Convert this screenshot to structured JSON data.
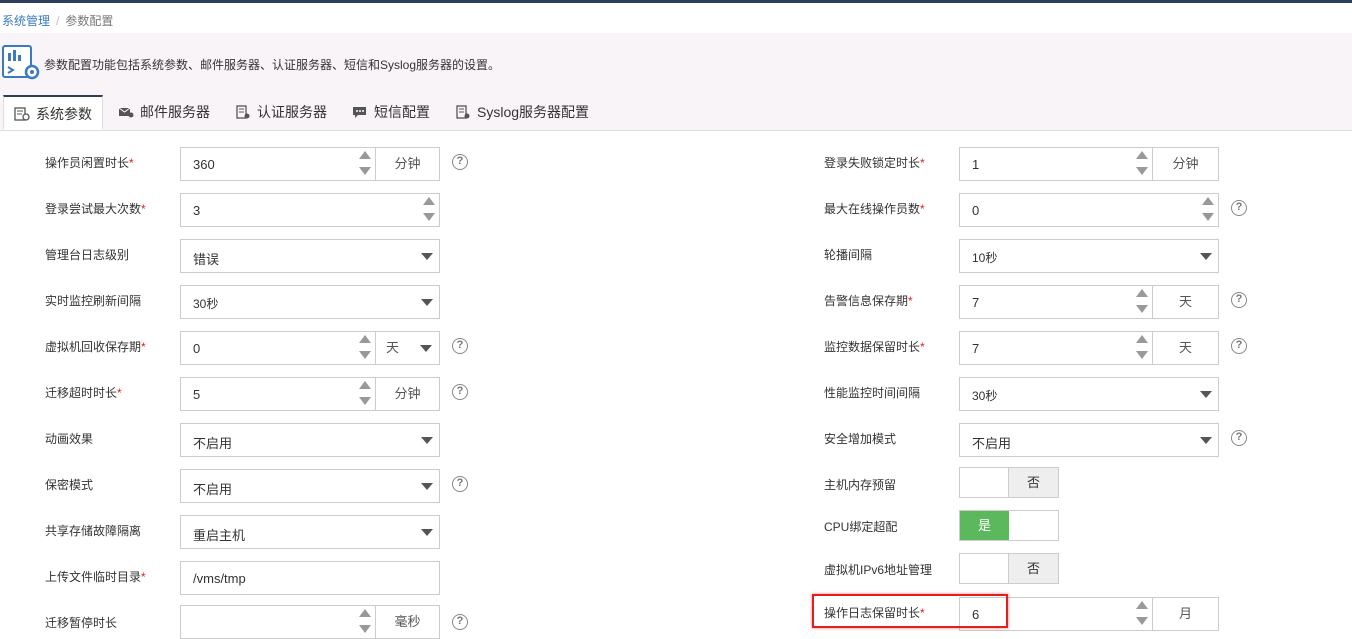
{
  "breadcrumb": {
    "parent": "系统管理",
    "separator": "/",
    "current": "参数配置"
  },
  "banner": {
    "description": "参数配置功能包括系统参数、邮件服务器、认证服务器、短信和Syslog服务器的设置。"
  },
  "tabs": [
    {
      "label": "系统参数",
      "icon": "settings-doc-icon",
      "active": true
    },
    {
      "label": "邮件服务器",
      "icon": "mail-icon"
    },
    {
      "label": "认证服务器",
      "icon": "server-icon"
    },
    {
      "label": "短信配置",
      "icon": "message-icon"
    },
    {
      "label": "Syslog服务器配置",
      "icon": "syslog-icon"
    }
  ],
  "left": {
    "idle_timeout": {
      "label": "操作员闲置时长",
      "value": "360",
      "unit": "分钟"
    },
    "max_login_attempts": {
      "label": "登录尝试最大次数",
      "value": "3"
    },
    "console_log_level": {
      "label": "管理台日志级别",
      "value": "错误"
    },
    "monitor_refresh": {
      "label": "实时监控刷新间隔",
      "value": "30秒"
    },
    "vm_recycle": {
      "label": "虚拟机回收保存期",
      "value": "0",
      "unit": "天"
    },
    "migration_timeout": {
      "label": "迁移超时时长",
      "value": "5",
      "unit": "分钟"
    },
    "animation": {
      "label": "动画效果",
      "value": "不启用"
    },
    "secret_mode": {
      "label": "保密模式",
      "value": "不启用"
    },
    "shared_storage_isolation": {
      "label": "共享存储故障隔离",
      "value": "重启主机"
    },
    "upload_temp_dir": {
      "label": "上传文件临时目录",
      "value": "/vms/tmp"
    },
    "migration_pause": {
      "label": "迁移暂停时长",
      "value": "",
      "unit": "毫秒"
    }
  },
  "right": {
    "login_lock": {
      "label": "登录失败锁定时长",
      "value": "1",
      "unit": "分钟"
    },
    "max_online_operators": {
      "label": "最大在线操作员数",
      "value": "0"
    },
    "carousel_interval": {
      "label": "轮播间隔",
      "value": "10秒"
    },
    "alarm_retention": {
      "label": "告警信息保存期",
      "value": "7",
      "unit": "天"
    },
    "monitor_data_retention": {
      "label": "监控数据保留时长",
      "value": "7",
      "unit": "天"
    },
    "perf_monitor_interval": {
      "label": "性能监控时间间隔",
      "value": "30秒"
    },
    "security_mode": {
      "label": "安全增加模式",
      "value": "不启用"
    },
    "host_mem_reserve": {
      "label": "主机内存预留",
      "value": "否",
      "on": false
    },
    "cpu_binding": {
      "label": "CPU绑定超配",
      "value": "是",
      "on": true
    },
    "vm_ipv6": {
      "label": "虚拟机IPv6地址管理",
      "value": "否",
      "on": false
    },
    "oplog_retention": {
      "label": "操作日志保留时长",
      "value": "6",
      "unit": "月"
    }
  },
  "help_glyph": "?",
  "required_mark": "*",
  "colors": {
    "accent": "#2c3e5c",
    "link": "#3a7bbf",
    "toggle_on": "#5cb85c",
    "required": "#e02020",
    "highlight": "#e02020"
  }
}
